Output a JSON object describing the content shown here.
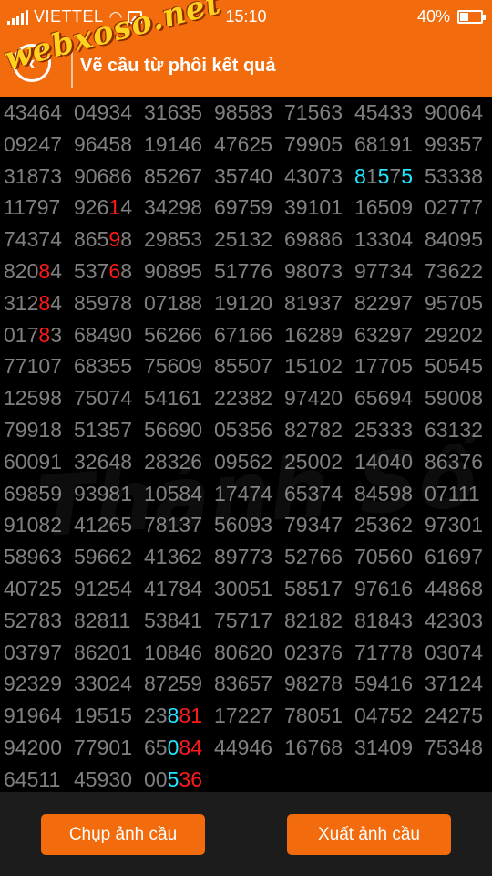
{
  "status": {
    "carrier": "VIETTEL",
    "time": "15:10",
    "battery": "40%",
    "battery_level": 0.4
  },
  "header": {
    "title": "Vẽ cầu từ phôi kết quả",
    "logo_text": "webxoso.net",
    "bg_watermark": "Thánh Số"
  },
  "colors": {
    "accent": "#f26c0d",
    "number_gray": "#808080",
    "highlight_red": "#ff1a1a",
    "highlight_cyan": "#22e5ff"
  },
  "grid": [
    [
      "43464",
      "04934",
      "31635",
      "98583",
      "71563",
      "45433",
      "90064"
    ],
    [
      "09247",
      "96458",
      "19146",
      "47625",
      "79905",
      "68191",
      "99357"
    ],
    [
      "31873",
      "90686",
      "85267",
      "35740",
      "43073",
      "81575",
      "53338"
    ],
    [
      "11797",
      "92614",
      "34298",
      "69759",
      "39101",
      "16509",
      "02777"
    ],
    [
      "74374",
      "86598",
      "29853",
      "25132",
      "69886",
      "13304",
      "84095"
    ],
    [
      "82084",
      "53768",
      "90895",
      "51776",
      "98073",
      "97734",
      "73622"
    ],
    [
      "31284",
      "85978",
      "07188",
      "19120",
      "81937",
      "82297",
      "95705"
    ],
    [
      "01783",
      "68490",
      "56266",
      "67166",
      "16289",
      "63297",
      "29202"
    ],
    [
      "77107",
      "68355",
      "75609",
      "85507",
      "15102",
      "17705",
      "50545"
    ],
    [
      "12598",
      "75074",
      "54161",
      "22382",
      "97420",
      "65694",
      "59008"
    ],
    [
      "79918",
      "51357",
      "56690",
      "05356",
      "82782",
      "25333",
      "63132"
    ],
    [
      "60091",
      "32648",
      "28326",
      "09562",
      "25002",
      "14040",
      "86376"
    ],
    [
      "69859",
      "93981",
      "10584",
      "17474",
      "65374",
      "84598",
      "07111"
    ],
    [
      "91082",
      "41265",
      "78137",
      "56093",
      "79347",
      "25362",
      "97301"
    ],
    [
      "58963",
      "59662",
      "41362",
      "89773",
      "52766",
      "70560",
      "61697"
    ],
    [
      "40725",
      "91254",
      "41784",
      "30051",
      "58517",
      "97616",
      "44868"
    ],
    [
      "52783",
      "82811",
      "53841",
      "75717",
      "82182",
      "81843",
      "42303"
    ],
    [
      "03797",
      "86201",
      "10846",
      "80620",
      "02376",
      "71778",
      "03074"
    ],
    [
      "92329",
      "33024",
      "87259",
      "83657",
      "98278",
      "59416",
      "37124"
    ],
    [
      "91964",
      "19515",
      "23881",
      "17227",
      "78051",
      "04752",
      "24275"
    ],
    [
      "94200",
      "77901",
      "65084",
      "44946",
      "16768",
      "31409",
      "75348"
    ],
    [
      "64511",
      "45930",
      "00536"
    ]
  ],
  "highlights": [
    {
      "row": 2,
      "col": 5,
      "digit": 0,
      "color": "cyan"
    },
    {
      "row": 2,
      "col": 5,
      "digit": 2,
      "color": "cyan"
    },
    {
      "row": 2,
      "col": 5,
      "digit": 4,
      "color": "cyan"
    },
    {
      "row": 3,
      "col": 1,
      "digit": 3,
      "color": "red"
    },
    {
      "row": 4,
      "col": 1,
      "digit": 3,
      "color": "red"
    },
    {
      "row": 5,
      "col": 0,
      "digit": 3,
      "color": "red"
    },
    {
      "row": 5,
      "col": 1,
      "digit": 3,
      "color": "red"
    },
    {
      "row": 6,
      "col": 0,
      "digit": 3,
      "color": "red"
    },
    {
      "row": 7,
      "col": 0,
      "digit": 3,
      "color": "red"
    },
    {
      "row": 19,
      "col": 2,
      "digit": 2,
      "color": "cyan"
    },
    {
      "row": 19,
      "col": 2,
      "digit": 3,
      "color": "red"
    },
    {
      "row": 19,
      "col": 2,
      "digit": 4,
      "color": "red"
    },
    {
      "row": 20,
      "col": 2,
      "digit": 2,
      "color": "cyan"
    },
    {
      "row": 20,
      "col": 2,
      "digit": 3,
      "color": "red"
    },
    {
      "row": 20,
      "col": 2,
      "digit": 4,
      "color": "red"
    },
    {
      "row": 21,
      "col": 2,
      "digit": 2,
      "color": "cyan"
    },
    {
      "row": 21,
      "col": 2,
      "digit": 3,
      "color": "red"
    },
    {
      "row": 21,
      "col": 2,
      "digit": 4,
      "color": "red"
    }
  ],
  "footer": {
    "capture_label": "Chụp ảnh cầu",
    "export_label": "Xuất ảnh cầu"
  }
}
